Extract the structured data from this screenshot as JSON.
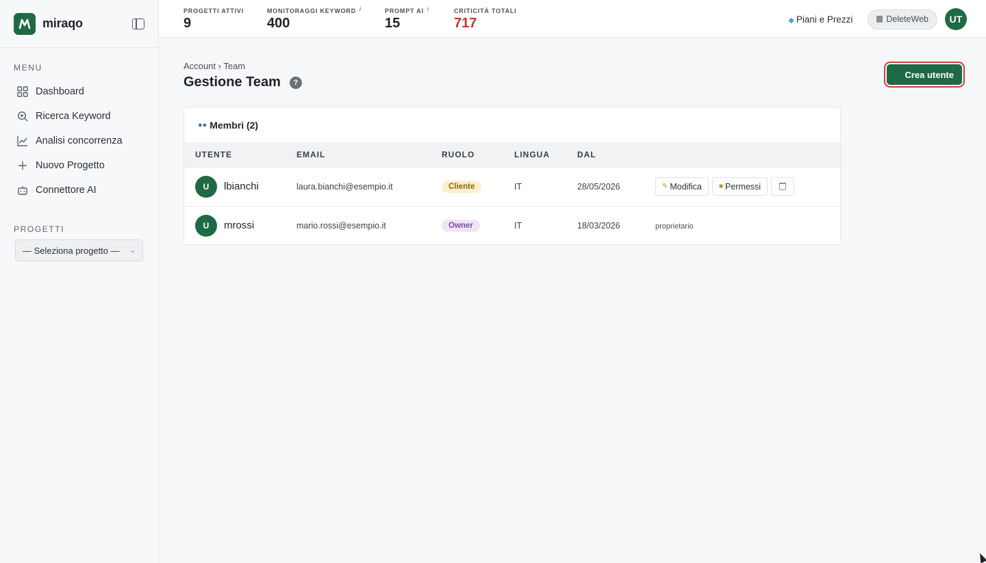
{
  "brand": {
    "name": "miraqo",
    "logo_letter": "M",
    "color": "#1e6a45"
  },
  "sidebar": {
    "menu_label": "MENU",
    "items": [
      {
        "label": "Dashboard",
        "icon": "grid-icon"
      },
      {
        "label": "Ricerca Keyword",
        "icon": "search-plus-icon"
      },
      {
        "label": "Analisi concorrenza",
        "icon": "chart-line-icon"
      },
      {
        "label": "Nuovo Progetto",
        "icon": "plus-icon"
      },
      {
        "label": "Connettore AI",
        "icon": "robot-icon"
      }
    ],
    "projects_label": "PROGETTI",
    "project_select": "— Seleziona progetto —"
  },
  "topbar": {
    "stats": [
      {
        "label": "PROGETTI ATTIVI",
        "value": "9",
        "info": ""
      },
      {
        "label": "MONITORAGGI KEYWORD",
        "value": "400",
        "info": "i"
      },
      {
        "label": "PROMPT AI",
        "value": "15",
        "info": "i"
      },
      {
        "label": "CRITICITÀ TOTALI",
        "value": "717",
        "info": "",
        "color": "#c0392b"
      }
    ],
    "pricing": "Piani e Prezzi",
    "workspace": "DeleteWeb",
    "user_initials": "UT"
  },
  "page": {
    "breadcrumb": {
      "root": "Account",
      "sep": "›",
      "current": "Team"
    },
    "title": "Gestione Team",
    "help": "?",
    "create_button": "Crea utente"
  },
  "members": {
    "header": "Membri (2)",
    "columns": [
      "UTENTE",
      "EMAIL",
      "RUOLO",
      "LINGUA",
      "DAL"
    ],
    "rows": [
      {
        "initial": "U",
        "username": "lbianchi",
        "email": "laura.bianchi@esempio.it",
        "role": "Cliente",
        "lang": "IT",
        "since": "28/05/2026",
        "edit": "Modifica",
        "perms": "Permessi"
      },
      {
        "initial": "U",
        "username": "mrossi",
        "email": "mario.rossi@esempio.it",
        "role": "Owner",
        "lang": "IT",
        "since": "18/03/2026",
        "note": "proprietario"
      }
    ]
  }
}
